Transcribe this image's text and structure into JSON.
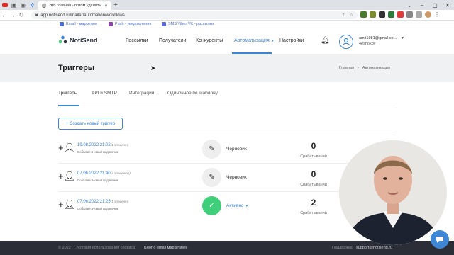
{
  "browser": {
    "active_tab_title": "Это главная - потом удалить",
    "url": "app.notisend.ru/mailer/automation/workflows"
  },
  "top_links": [
    "Email - маркетинг",
    "Push - уведомления",
    "SMS Viber VK - рассылки"
  ],
  "header": {
    "logo": "NotiSend",
    "nav": [
      "Рассылки",
      "Получатели",
      "Конкуренты",
      "Автоматизация",
      "Настройки"
    ],
    "user_email": "amfi1981@gmail.co...",
    "user_name": "4esnokov"
  },
  "page": {
    "title": "Триггеры",
    "breadcrumb": [
      "Главная",
      "Автоматизация"
    ]
  },
  "subtabs": [
    "Триггеры",
    "API и SMTP",
    "Интеграции",
    "Одиночное по шаблону"
  ],
  "create_button": "+ Создать новый триггер",
  "triggers": [
    {
      "date": "19.08.2022 21:02",
      "count": "(1 элемент)",
      "event": "Событие: Новый подписчик",
      "status": "Черновик",
      "value": "0",
      "metric": "Срабатываний"
    },
    {
      "date": "07.06.2022 21:40",
      "count": "(4 элемента)",
      "event": "Событие: Новый подписчик",
      "status": "Черновик",
      "value": "0",
      "metric": "Срабатываний"
    },
    {
      "date": "07.06.2022 21:25",
      "count": "(1 элемент)",
      "event": "Событие: Новый подписчик",
      "status": "Активно",
      "value": "2",
      "metric": "Срабатываний"
    }
  ],
  "footer": {
    "copyright": "© 2022",
    "terms": "Условия использования сервиса",
    "blog": "Блог о email маркетинге",
    "support": "Поддержка:",
    "support_email": "support@notisend.ru"
  }
}
